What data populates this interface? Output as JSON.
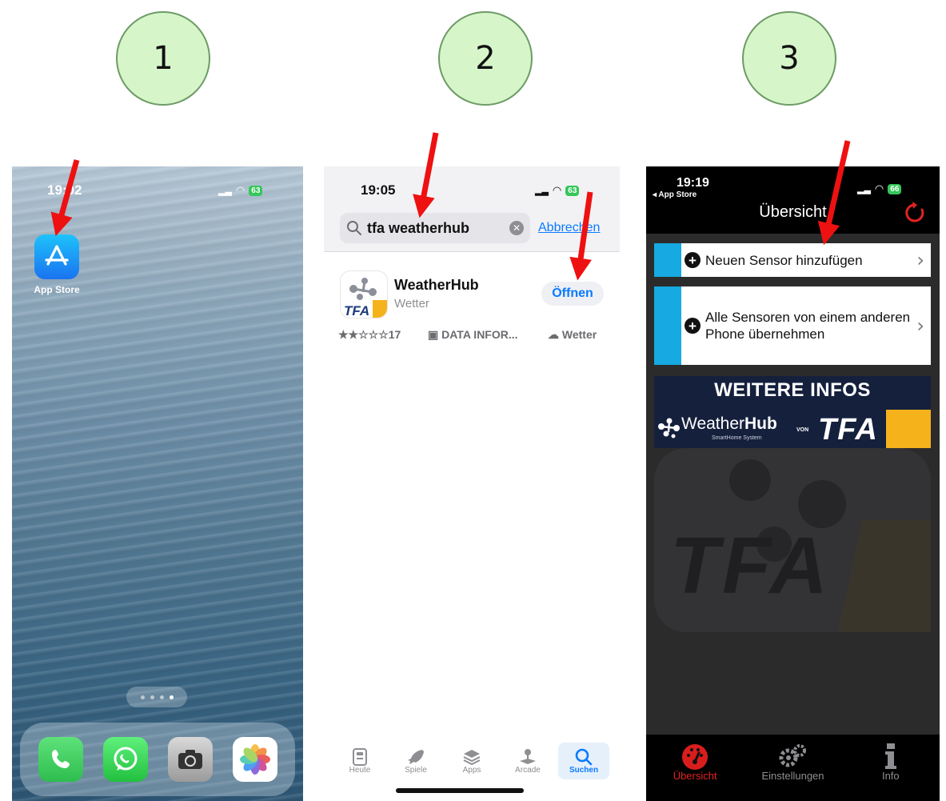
{
  "steps": [
    "1",
    "2",
    "3"
  ],
  "phone1": {
    "status_time": "19:02",
    "battery": "63",
    "app_label": "App Store",
    "dock_apps": [
      "phone-icon",
      "whatsapp-icon",
      "camera-icon",
      "photos-icon"
    ]
  },
  "phone2": {
    "status_time": "19:05",
    "battery": "63",
    "search_query": "tfa weatherhub",
    "cancel_label": "Abbrechen",
    "result": {
      "name": "WeatherHub",
      "category": "Wetter",
      "action_label": "Öffnen",
      "rating": "★★☆☆☆17",
      "developer": "DATA INFOR...",
      "genre": "Wetter",
      "icon_text": "TFA"
    },
    "tabs": [
      {
        "label": "Heute",
        "icon": "today-icon"
      },
      {
        "label": "Spiele",
        "icon": "rocket-icon"
      },
      {
        "label": "Apps",
        "icon": "layers-icon"
      },
      {
        "label": "Arcade",
        "icon": "joystick-icon"
      },
      {
        "label": "Suchen",
        "icon": "search-icon"
      }
    ]
  },
  "phone3": {
    "status_time": "19:19",
    "battery": "66",
    "back_label": "◂ App Store",
    "title": "Übersicht",
    "menu": [
      {
        "label": "Neuen Sensor hinzufügen"
      },
      {
        "label": "Alle Sensoren von einem anderen Phone übernehmen"
      }
    ],
    "banner": {
      "title": "WEITERE INFOS",
      "weather": "Weather",
      "hub": "Hub",
      "subtitle": "SmartHome System",
      "von": "VON",
      "brand": "TFA"
    },
    "watermark": "TFA",
    "tabs": [
      {
        "label": "Übersicht",
        "icon": "gauge-icon"
      },
      {
        "label": "Einstellungen",
        "icon": "gears-icon"
      },
      {
        "label": "Info",
        "icon": "info-icon"
      }
    ],
    "colors": {
      "accent": "#17a9e1",
      "active_tab": "#e32222",
      "banner_bg": "#15203d",
      "banner_gold": "#f5b21b"
    }
  }
}
